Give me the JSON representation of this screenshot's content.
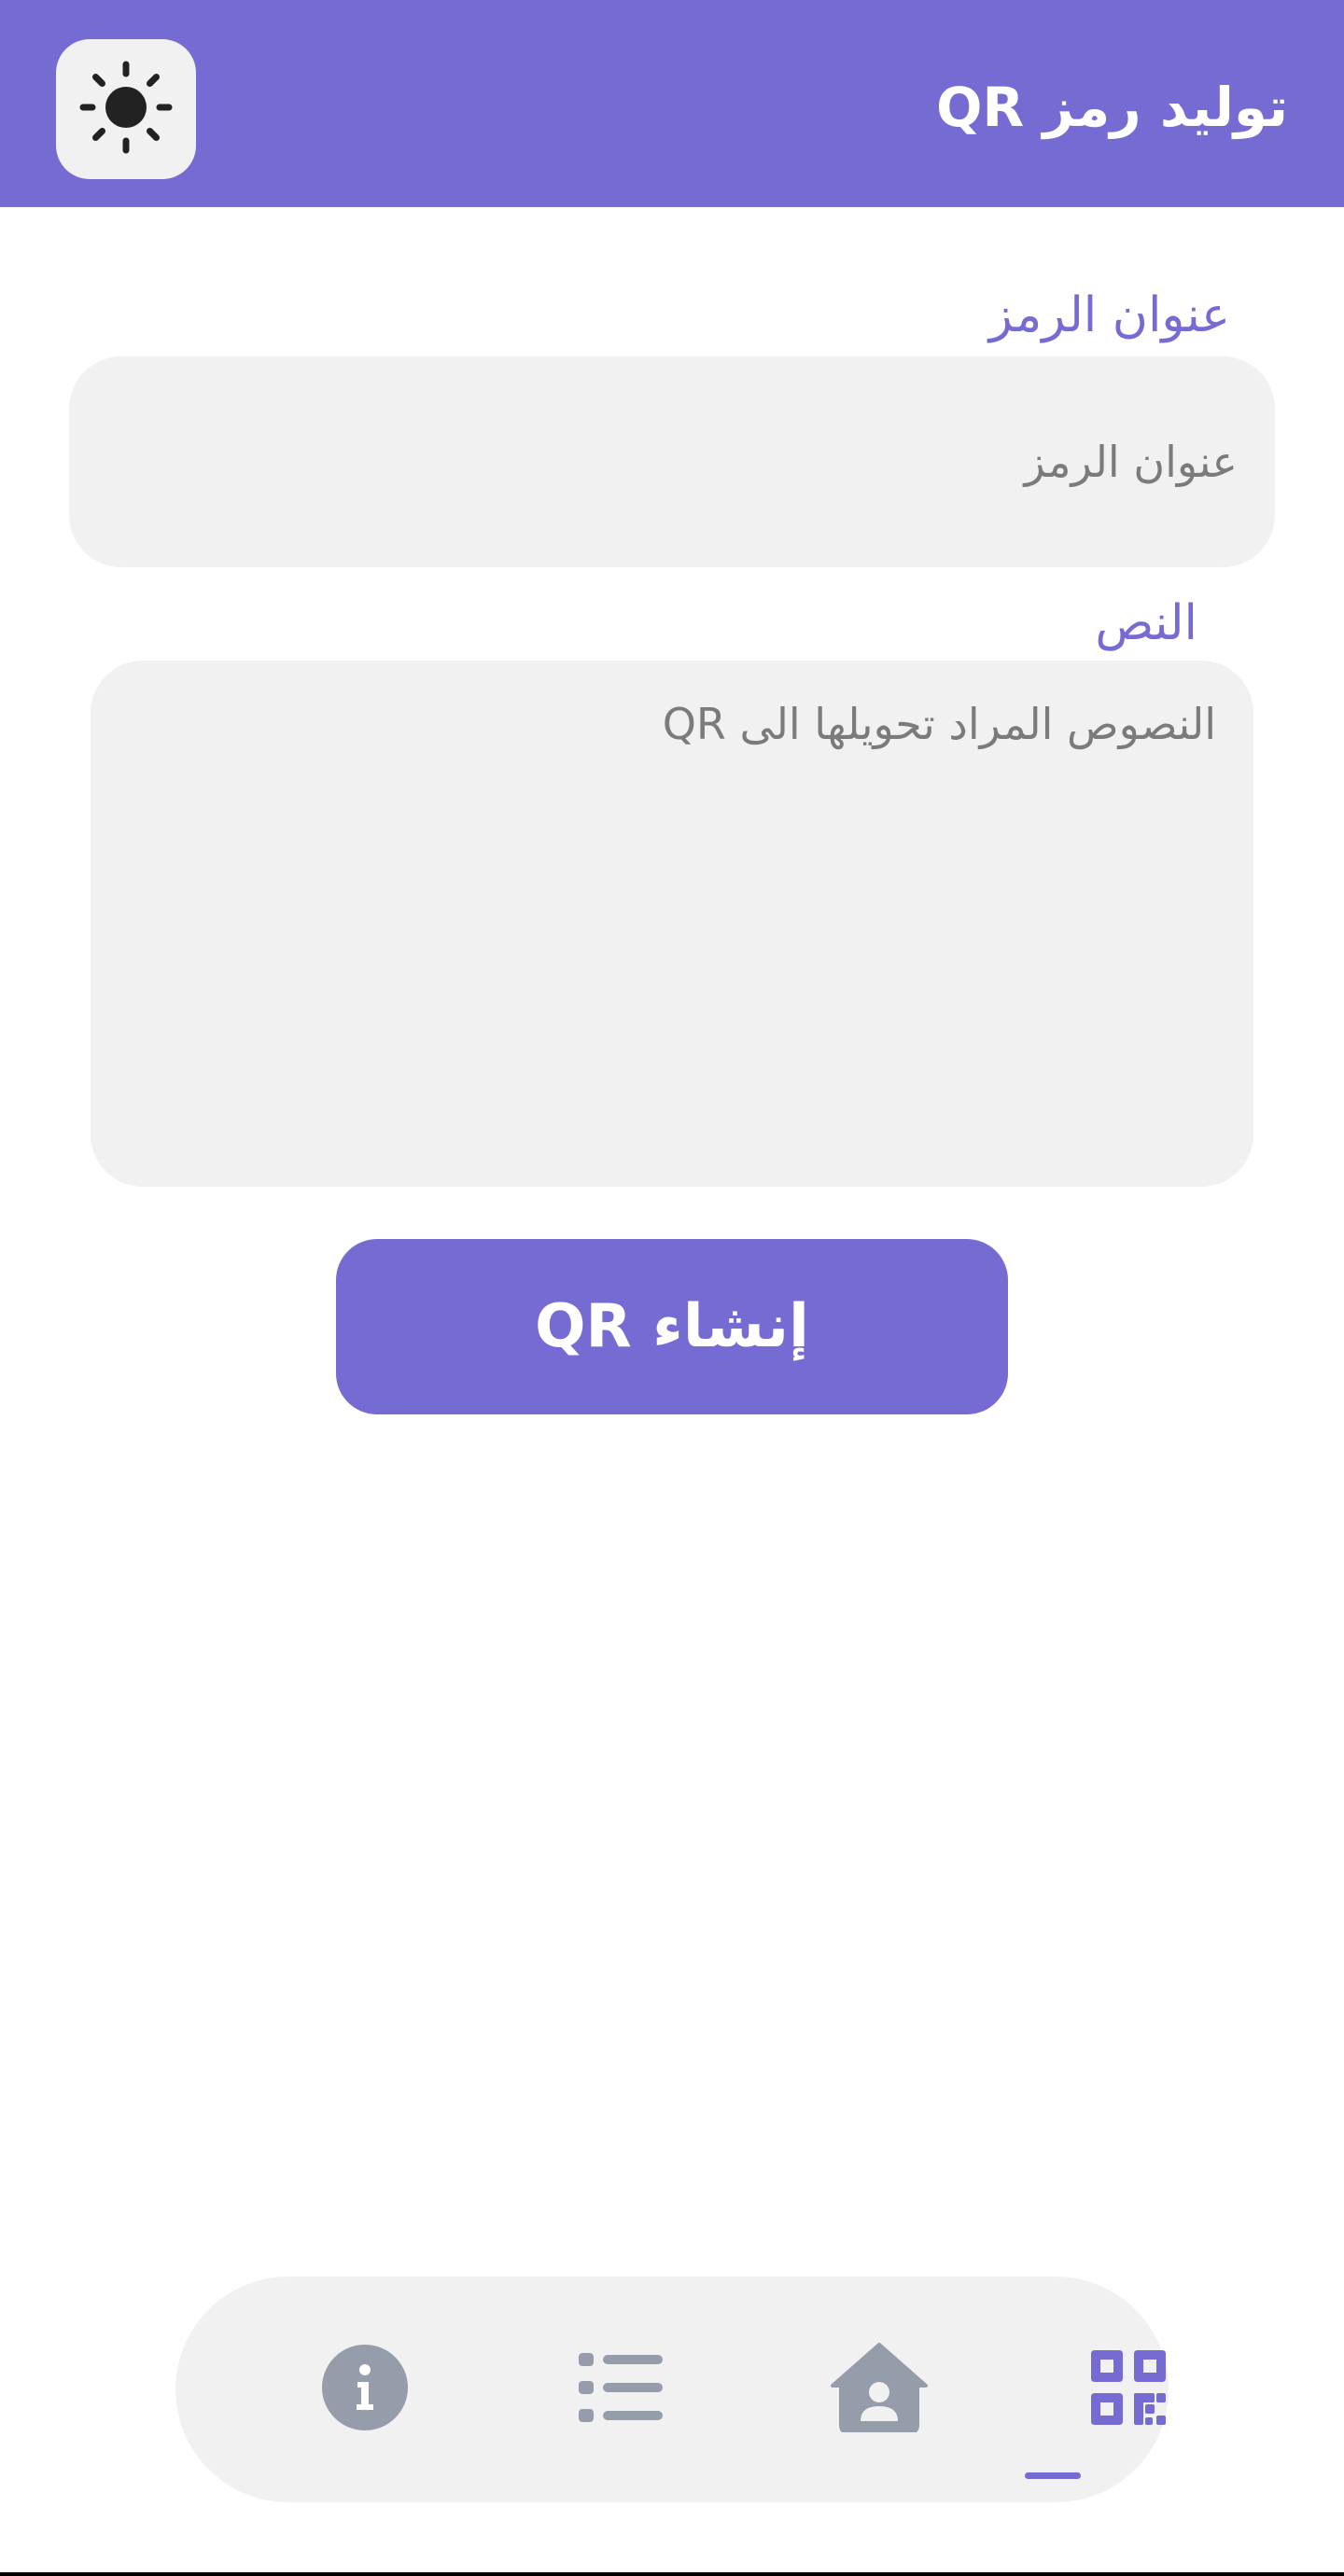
{
  "header": {
    "title": "توليد رمز QR",
    "theme_toggle_icon": "sun-icon"
  },
  "form": {
    "title_label": "عنوان الرمز",
    "title_placeholder": "عنوان الرمز",
    "title_value": "",
    "text_label": "النص",
    "text_placeholder": "النصوص المراد تحويلها الى QR",
    "text_value": "",
    "submit_label": "إنشاء QR"
  },
  "bottom_nav": {
    "items": [
      {
        "icon": "info-icon",
        "active": false
      },
      {
        "icon": "list-icon",
        "active": false
      },
      {
        "icon": "home-user-icon",
        "active": false
      },
      {
        "icon": "qr-code-icon",
        "active": true
      }
    ]
  },
  "colors": {
    "primary": "#766bd3",
    "surface": "#f1f1f1",
    "inactive_icon": "#959daa",
    "placeholder": "#7b7b7b"
  }
}
